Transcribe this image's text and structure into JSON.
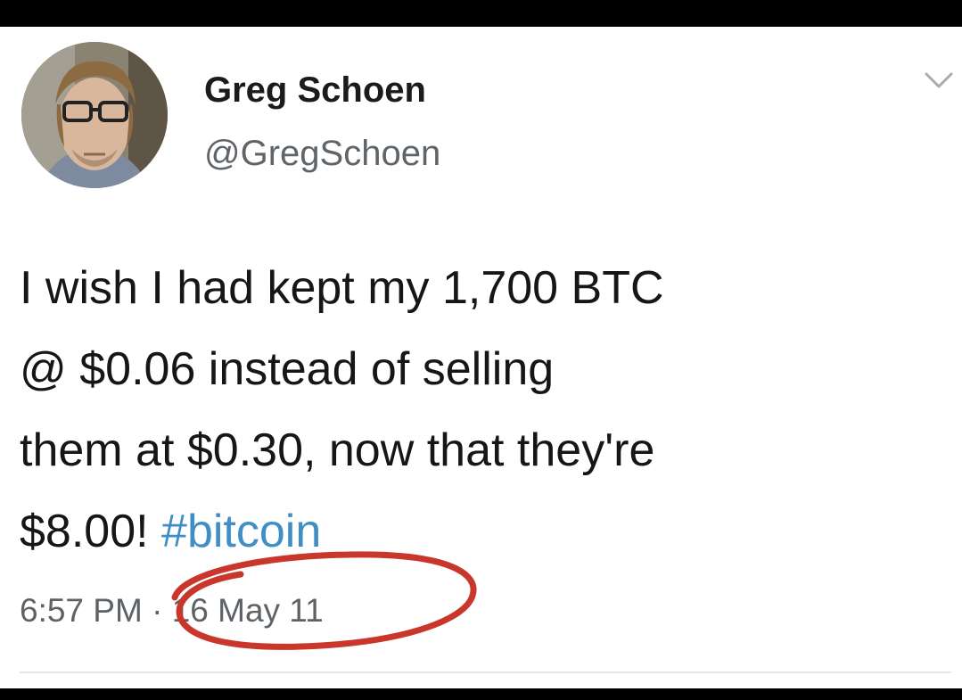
{
  "author": {
    "display_name": "Greg Schoen",
    "handle": "@GregSchoen"
  },
  "tweet": {
    "lines": [
      "I wish I had kept my 1,700 BTC",
      "@ $0.06 instead of selling",
      "them at $0.30, now that they're",
      "$8.00!"
    ],
    "hashtag": "#bitcoin",
    "time": "6:57 PM",
    "separator": " · ",
    "date": "16 May 11"
  },
  "icons": {
    "menu": "chevron-down-icon",
    "avatar": "profile-photo",
    "annotation": "red-hand-drawn-circle"
  },
  "colors": {
    "hashtag": "#3f8ec6",
    "annotation": "#c9372c",
    "timestamp": "#5d6266"
  }
}
